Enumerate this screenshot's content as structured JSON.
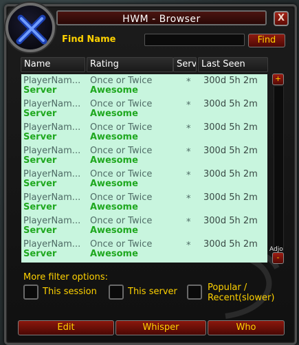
{
  "window": {
    "title": "HWM - Browser",
    "close_label": "X"
  },
  "find": {
    "label": "Find Name",
    "value": "",
    "button_label": "Find"
  },
  "columns": [
    "Name",
    "Rating",
    "Serv",
    "Last Seen"
  ],
  "rows": [
    {
      "name": "PlayerNam...",
      "server": "Server",
      "rating": "Once or Twice",
      "rating_label": "Awesome",
      "serv": "*",
      "last_seen": "300d 5h 2m"
    },
    {
      "name": "PlayerNam...",
      "server": "Server",
      "rating": "Once or Twice",
      "rating_label": "Awesome",
      "serv": "*",
      "last_seen": "300d 5h 2m"
    },
    {
      "name": "PlayerNam...",
      "server": "Server",
      "rating": "Once or Twice",
      "rating_label": "Awesome",
      "serv": "*",
      "last_seen": "300d 5h 2m"
    },
    {
      "name": "PlayerNam...",
      "server": "Server",
      "rating": "Once or Twice",
      "rating_label": "Awesome",
      "serv": "*",
      "last_seen": "300d 5h 2m"
    },
    {
      "name": "PlayerNam...",
      "server": "Server",
      "rating": "Once or Twice",
      "rating_label": "Awesome",
      "serv": "*",
      "last_seen": "300d 5h 2m"
    },
    {
      "name": "PlayerNam...",
      "server": "Server",
      "rating": "Once or Twice",
      "rating_label": "Awesome",
      "serv": "*",
      "last_seen": "300d 5h 2m"
    },
    {
      "name": "PlayerNam...",
      "server": "Server",
      "rating": "Once or Twice",
      "rating_label": "Awesome",
      "serv": "*",
      "last_seen": "300d 5h 2m"
    },
    {
      "name": "PlayerNam...",
      "server": "Server",
      "rating": "Once or Twice",
      "rating_label": "Awesome",
      "serv": "*",
      "last_seen": "300d 5h 2m"
    }
  ],
  "scroll": {
    "up_icon": "+",
    "down_icon": "-",
    "adjust_label": "Adjo"
  },
  "filters": {
    "label": "More filter options:",
    "this_session": "This session",
    "this_server": "This server",
    "popular_line1": "Popular /",
    "popular_line2": "Recent(slower)"
  },
  "buttons": {
    "edit": "Edit",
    "whisper": "Whisper",
    "who": "Who"
  },
  "colors": {
    "list_bg": "#c8f5de",
    "label_gold": "#ffd200",
    "server_green": "#1fa81f",
    "button_red": "#8b170d"
  },
  "icons": {
    "portrait": "crossed-swords-icon"
  }
}
